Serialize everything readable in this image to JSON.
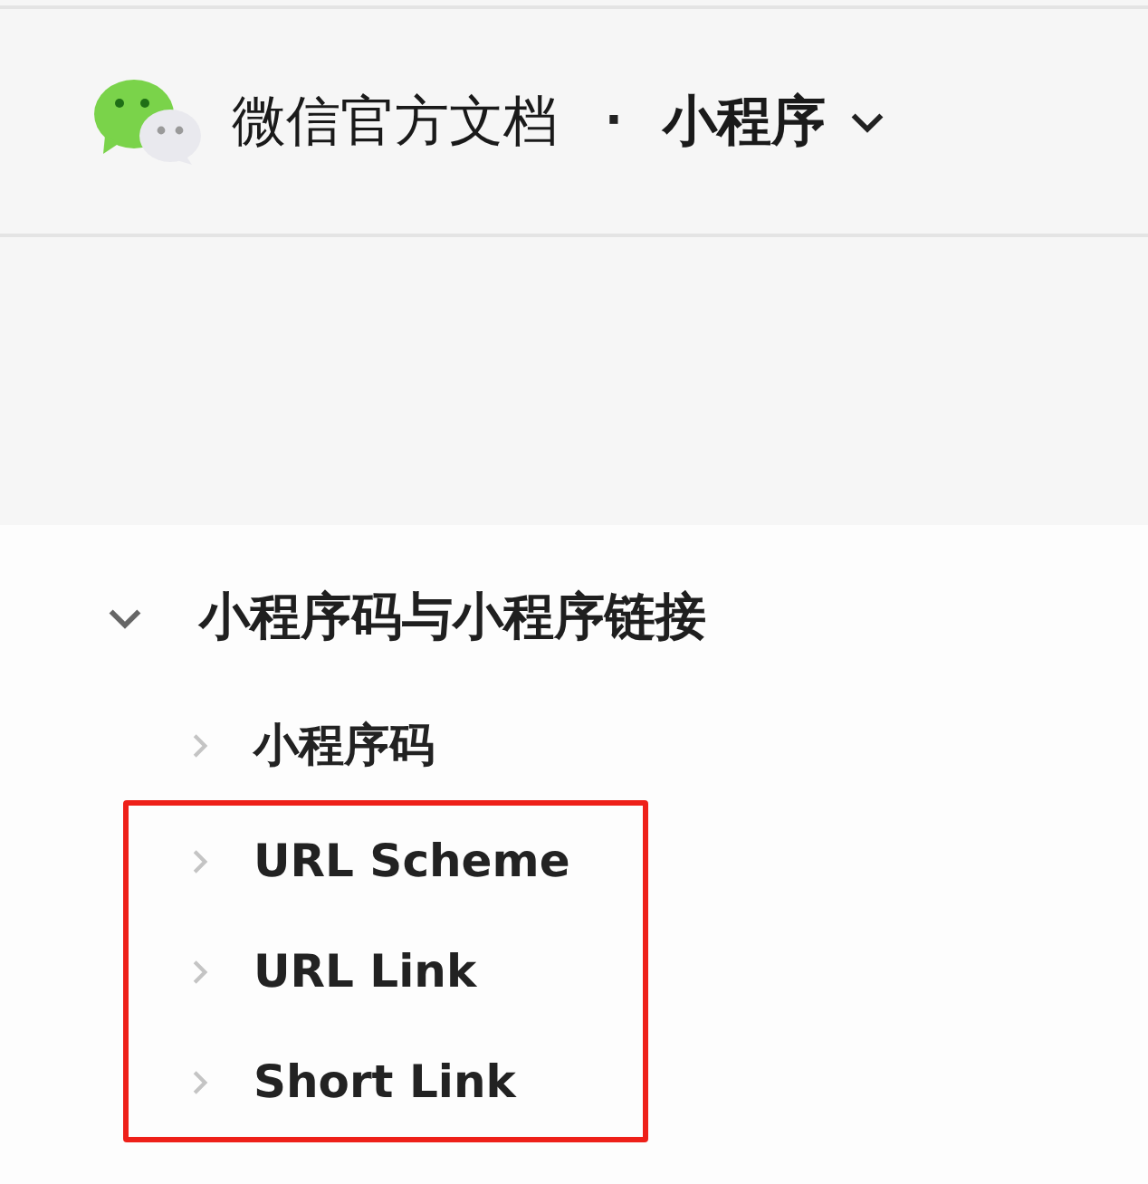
{
  "header": {
    "site_title": "微信官方文档",
    "separator": "·",
    "section": "小程序",
    "section_menu_expanded": false
  },
  "tree": [
    {
      "label": "小程序码与小程序链接",
      "expanded": true,
      "children": [
        {
          "label": "小程序码",
          "expanded": false,
          "highlighted": false
        },
        {
          "label": "URL Scheme",
          "expanded": false,
          "highlighted": true
        },
        {
          "label": "URL Link",
          "expanded": false,
          "highlighted": true
        },
        {
          "label": "Short Link",
          "expanded": false,
          "highlighted": true
        }
      ]
    }
  ]
}
